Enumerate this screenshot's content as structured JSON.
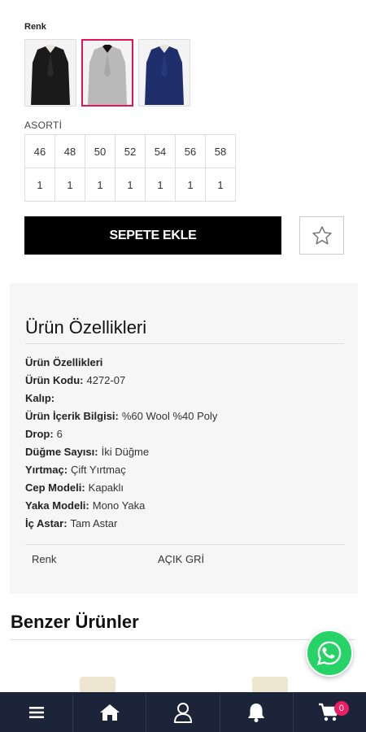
{
  "product": {
    "color_label": "Renk",
    "color_swatches": [
      {
        "name": "black-jacket",
        "color": "#1a1a1a"
      },
      {
        "name": "grey-jacket",
        "color": "#b9b9b9"
      },
      {
        "name": "navy-jacket",
        "color": "#1f2f6b"
      }
    ],
    "selected_swatch": 1,
    "selected_color": "#e0155a"
  },
  "sizes": {
    "label": "ASORTİ",
    "sizes": [
      "46",
      "48",
      "50",
      "52",
      "54",
      "56",
      "58"
    ],
    "quantities": [
      "1",
      "1",
      "1",
      "1",
      "1",
      "1",
      "1"
    ]
  },
  "actions": {
    "add_to_cart_label": "SEPETE EKLE",
    "favorite_icon": "star-outline-icon"
  },
  "properties": {
    "title": "Ürün Özellikleri",
    "rows": [
      {
        "label": "Ürün Özellikleri",
        "value": ""
      },
      {
        "label": "Ürün Kodu:",
        "value": "4272-07"
      },
      {
        "label": "Kalıp:",
        "value": ""
      },
      {
        "label": "Ürün İçerik Bilgisi:",
        "value": "%60 Wool %40 Poly"
      },
      {
        "label": "Drop:",
        "value": "6"
      },
      {
        "label": "Düğme Sayısı:",
        "value": "İki Düğme"
      },
      {
        "label": "Yırtmaç:",
        "value": "Çift Yırtmaç"
      },
      {
        "label": "Cep Modeli:",
        "value": "Kapaklı"
      },
      {
        "label": "Yaka Modeli:",
        "value": "Mono Yaka"
      },
      {
        "label": "İç Astar:",
        "value": "Tam Astar"
      }
    ],
    "attribute": {
      "key": "Renk",
      "value": "AÇIK GRİ"
    }
  },
  "similar": {
    "title": "Benzer Ürünler"
  },
  "floating": {
    "whatsapp_icon": "whatsapp-icon",
    "whatsapp_color": "#25d366"
  },
  "bottom_nav": {
    "items": [
      "menu-icon",
      "home-icon",
      "user-icon",
      "bell-icon",
      "cart-icon"
    ],
    "cart_count": "0",
    "background": "#1c2439",
    "badge_color": "#e91e63"
  }
}
